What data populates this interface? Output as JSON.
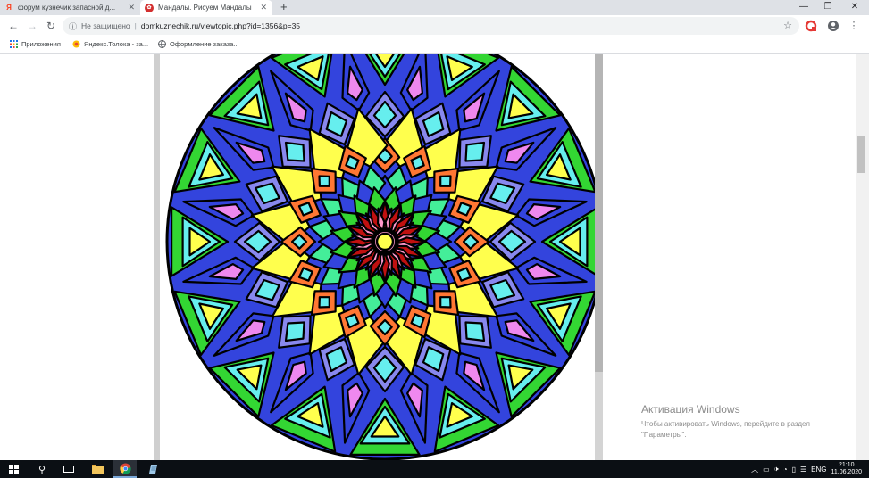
{
  "browser": {
    "tabs": [
      {
        "favicon": "yandex-icon",
        "title": "форум кузнечик запасной д...",
        "active": false
      },
      {
        "favicon": "site-icon",
        "title": "Мандалы. Рисуем Мандалы",
        "active": true
      }
    ],
    "new_tab_glyph": "+",
    "window_controls": {
      "minimize": "—",
      "maximize": "❐",
      "close": "✕"
    },
    "nav": {
      "back": "←",
      "forward": "→",
      "reload": "↻"
    },
    "omnibox": {
      "security": "Не защищено",
      "separator": "|",
      "url": "domkuznechik.ru/viewtopic.php?id=1356&p=35"
    },
    "bookmarks": [
      {
        "icon": "apps-icon",
        "label": "Приложения"
      },
      {
        "icon": "toloka-icon",
        "label": "Яндекс.Толока - за..."
      },
      {
        "icon": "globe-icon",
        "label": "Оформление заказа..."
      }
    ]
  },
  "page": {
    "image": "mandala",
    "colors": {
      "outline": "#000000",
      "green": "#33d633",
      "cyan": "#66eeee",
      "yellow": "#ffff4d",
      "blue": "#3344dd",
      "periwinkle": "#8888ee",
      "pink": "#ee88ee",
      "orange": "#ff7733",
      "mint": "#44ee99",
      "red": "#c01010",
      "rose": "#ff99cc"
    }
  },
  "activation": {
    "title": "Активация Windows",
    "line1": "Чтобы активировать Windows, перейдите в раздел",
    "line2": "\"Параметры\"."
  },
  "taskbar": {
    "tray": {
      "lang": "ENG",
      "time": "21:10",
      "date": "11.06.2020"
    }
  }
}
